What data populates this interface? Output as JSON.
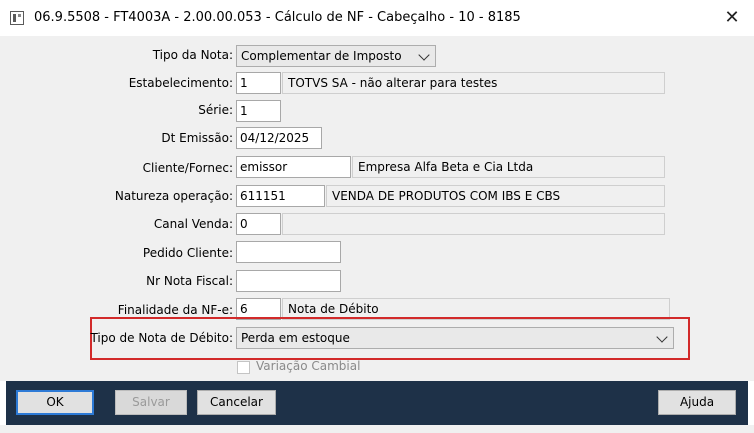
{
  "window": {
    "title": "06.9.5508 - FT4003A - 2.00.00.053 - Cálculo de NF - Cabeçalho - 10 - 8185",
    "close_symbol": "✕"
  },
  "form": {
    "tipo_nota": {
      "label": "Tipo da Nota:",
      "value": "Complementar de Imposto"
    },
    "estabelecimento": {
      "label": "Estabelecimento:",
      "code": "1",
      "description": "TOTVS SA - não alterar para testes"
    },
    "serie": {
      "label": "Série:",
      "value": "1"
    },
    "dt_emissao": {
      "label": "Dt Emissão:",
      "value": "04/12/2025"
    },
    "cliente": {
      "label": "Cliente/Fornec:",
      "code": "emissor",
      "description": "Empresa Alfa Beta e Cia Ltda"
    },
    "natureza": {
      "label": "Natureza operação:",
      "code": "611151",
      "description": "VENDA DE PRODUTOS COM IBS E CBS"
    },
    "canal_venda": {
      "label": "Canal Venda:",
      "code": "0",
      "description": ""
    },
    "pedido_cliente": {
      "label": "Pedido Cliente:",
      "value": ""
    },
    "nr_nota_fiscal": {
      "label": "Nr Nota Fiscal:",
      "value": ""
    },
    "finalidade": {
      "label": "Finalidade da NF-e:",
      "code": "6",
      "description": "Nota de Débito"
    },
    "tipo_nota_debito": {
      "label": "Tipo de Nota de Débito:",
      "value": "Perda em estoque"
    },
    "variacao_cambial": {
      "label": "Variação Cambial",
      "checked": false
    }
  },
  "buttons": {
    "ok": "OK",
    "salvar": "Salvar",
    "cancelar": "Cancelar",
    "ajuda": "Ajuda"
  },
  "colors": {
    "highlight": "#d22a2a",
    "footer": "#1e3148",
    "ok_border": "#2d7ad6"
  }
}
